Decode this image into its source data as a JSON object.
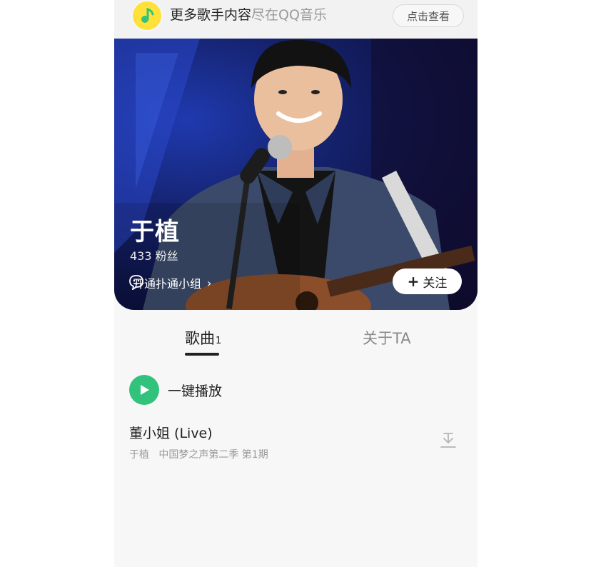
{
  "banner": {
    "text_main": "更多歌手内容",
    "text_grey": "尽在QQ音乐",
    "button_label": "点击查看",
    "logo_icon": "qq-music-icon"
  },
  "artist": {
    "name": "于植",
    "fans": "433 粉丝",
    "group_link": "开通扑通小组",
    "follow_label": "关注"
  },
  "tabs": {
    "songs_label": "歌曲",
    "songs_count": "1",
    "about_label": "关于TA"
  },
  "play_all": {
    "label": "一键播放"
  },
  "songs": [
    {
      "title": "董小姐 (Live)",
      "subtitle": "于植   中国梦之声第二季 第1期"
    }
  ],
  "colors": {
    "accent_green": "#31c27c",
    "logo_yellow": "#ffe13a"
  }
}
